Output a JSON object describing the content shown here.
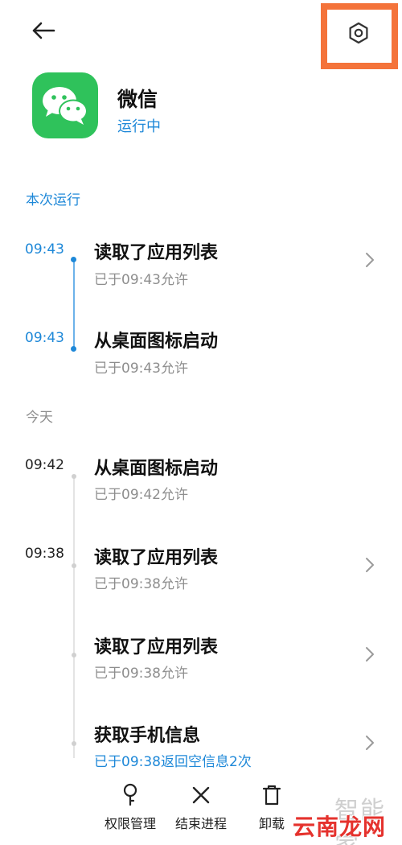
{
  "header": {
    "back_icon": "arrow-left-icon",
    "settings_icon": "hexagon-gear-icon"
  },
  "app": {
    "name": "微信",
    "status": "运行中",
    "icon": "wechat-logo-icon",
    "brand_color": "#2fc25b"
  },
  "sections": {
    "current_run": "本次运行",
    "today": "今天"
  },
  "events": [
    {
      "time": "09:43",
      "title": "读取了应用列表",
      "detail": "已于09:43允许",
      "has_chevron": true
    },
    {
      "time": "09:43",
      "title": "从桌面图标启动",
      "detail": "已于09:43允许",
      "has_chevron": false
    },
    {
      "time": "09:42",
      "title": "从桌面图标启动",
      "detail": "已于09:42允许",
      "has_chevron": false
    },
    {
      "time": "09:38",
      "title": "读取了应用列表",
      "detail": "已于09:38允许",
      "has_chevron": true
    },
    {
      "time": "",
      "title": "读取了应用列表",
      "detail": "已于09:38允许",
      "has_chevron": true
    },
    {
      "time": "",
      "title": "获取手机信息",
      "detail": "已于09:38返回空信息2次",
      "has_chevron": true
    }
  ],
  "actions": [
    {
      "label": "权限管理",
      "icon": "key-icon"
    },
    {
      "label": "结束进程",
      "icon": "close-icon"
    },
    {
      "label": "卸载",
      "icon": "trash-icon"
    }
  ],
  "watermark": {
    "top": "智能家",
    "bottom": "云南龙网"
  },
  "colors": {
    "accent": "#1e88d8",
    "highlight": "#f4733a"
  }
}
